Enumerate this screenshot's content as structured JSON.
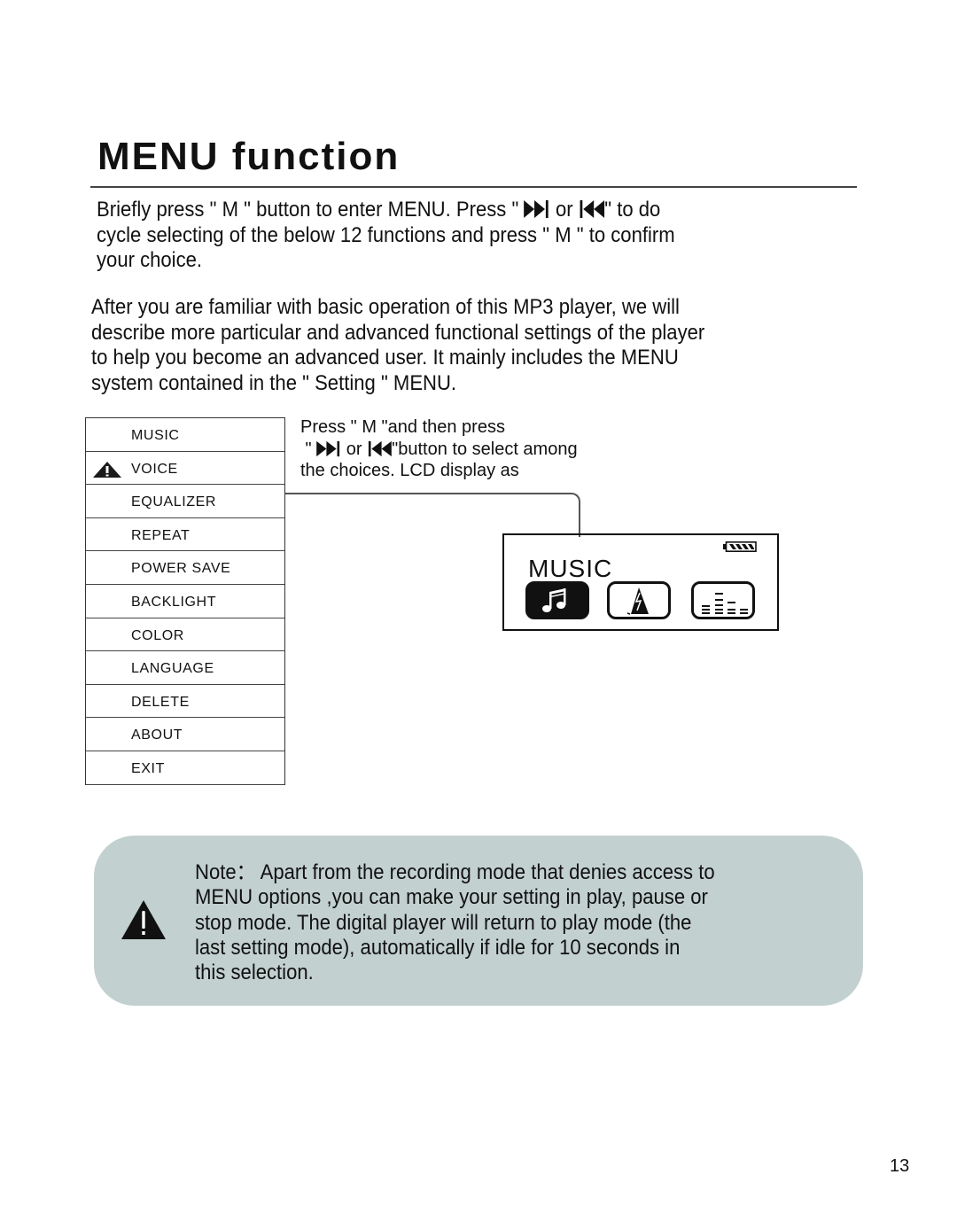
{
  "page": {
    "title": "MENU function",
    "intro_lines": [
      {
        "before": "Briefly press \" M \" button to enter MENU. Press \" ",
        "mid": " or ",
        "after": "\" to do"
      },
      "cycle selecting of the below 12 functions and press \" M \" to confirm",
      "your choice."
    ],
    "description_lines": [
      "After you are familiar with basic operation of this MP3 player, we will",
      "describe more particular and advanced functional settings of the player",
      "to help you become an advanced user. It mainly includes the MENU",
      "system contained in the \" Setting \" MENU."
    ],
    "menu_items": [
      {
        "label": "MUSIC",
        "icon": null
      },
      {
        "label": "VOICE",
        "icon": "warning-icon"
      },
      {
        "label": "EQUALIZER",
        "icon": null
      },
      {
        "label": "REPEAT",
        "icon": null
      },
      {
        "label": "POWER SAVE",
        "icon": null
      },
      {
        "label": "BACKLIGHT",
        "icon": null
      },
      {
        "label": "COLOR",
        "icon": null
      },
      {
        "label": "LANGUAGE",
        "icon": null
      },
      {
        "label": "DELETE",
        "icon": null
      },
      {
        "label": "ABOUT",
        "icon": null
      },
      {
        "label": "EXIT",
        "icon": null
      }
    ],
    "side_text": {
      "line1": "Press \" M \"and then press",
      "line2_before": " \" ",
      "line2_mid": " or ",
      "line2_after": "\"button to select among",
      "line3": "the choices. LCD display as"
    },
    "lcd": {
      "title": "MUSIC",
      "icons": [
        "music-note-icon",
        "metronome-icon",
        "equalizer-bars-icon"
      ],
      "active_icon": "music-note-icon",
      "battery_icon": "battery-full-icon"
    },
    "note": {
      "lines": [
        "Note： Apart from the recording mode that denies access to",
        "MENU options ,you can make your setting in play, pause or",
        "stop mode. The digital player will return to play mode (the",
        "last setting mode), automatically if idle for 10 seconds in",
        "this selection."
      ],
      "icon": "warning-icon",
      "background": "#c3d0d0"
    },
    "page_number": "13"
  }
}
